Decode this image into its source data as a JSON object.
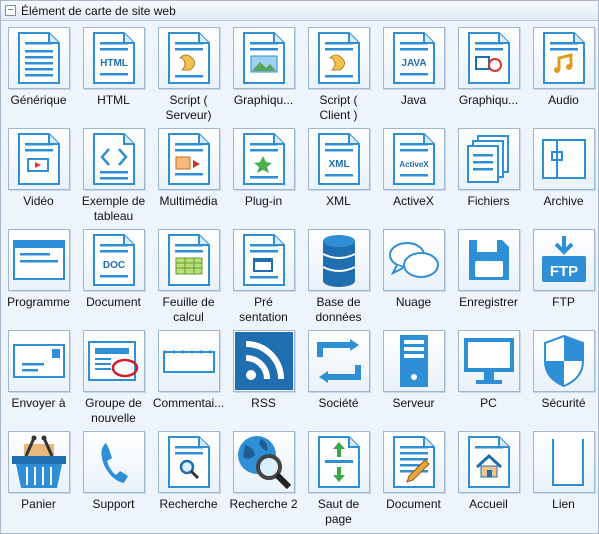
{
  "panel": {
    "title": "Élément de carte de site web",
    "collapse_symbol": "−"
  },
  "items": [
    {
      "label": "Générique",
      "icon": "generic-page-icon",
      "kind": "doc",
      "glyph": "lines"
    },
    {
      "label": "HTML",
      "icon": "html-page-icon",
      "kind": "doc",
      "glyph": "HTML"
    },
    {
      "label": "Script (\nServeur)",
      "icon": "server-script-icon",
      "kind": "doc",
      "glyph": "script"
    },
    {
      "label": "Graphiqu...",
      "icon": "graphic-page-icon",
      "kind": "doc",
      "glyph": "picture"
    },
    {
      "label": "Script (\nClient )",
      "icon": "client-script-icon",
      "kind": "doc",
      "glyph": "script"
    },
    {
      "label": "Java",
      "icon": "java-page-icon",
      "kind": "doc",
      "glyph": "JAVA"
    },
    {
      "label": "Graphiqu...",
      "icon": "graphic-shapes-icon",
      "kind": "doc",
      "glyph": "shapes"
    },
    {
      "label": "Audio",
      "icon": "audio-page-icon",
      "kind": "doc",
      "glyph": "note"
    },
    {
      "label": "Vidéo",
      "icon": "video-page-icon",
      "kind": "doc",
      "glyph": "video"
    },
    {
      "label": "Exemple de\ntableau",
      "icon": "template-page-icon",
      "kind": "doc",
      "glyph": "brackets"
    },
    {
      "label": "Multimédia",
      "icon": "multimedia-page-icon",
      "kind": "doc",
      "glyph": "media"
    },
    {
      "label": "Plug-in",
      "icon": "plugin-page-icon",
      "kind": "doc",
      "glyph": "star"
    },
    {
      "label": "XML",
      "icon": "xml-page-icon",
      "kind": "doc",
      "glyph": "XML"
    },
    {
      "label": "ActiveX",
      "icon": "activex-page-icon",
      "kind": "doc",
      "glyph": "ActiveX"
    },
    {
      "label": "Fichiers",
      "icon": "files-icon",
      "kind": "files"
    },
    {
      "label": "Archive",
      "icon": "archive-icon",
      "kind": "archive"
    },
    {
      "label": "Programme",
      "icon": "program-window-icon",
      "kind": "window"
    },
    {
      "label": "Document",
      "icon": "doc-file-icon",
      "kind": "doc",
      "glyph": "DOC"
    },
    {
      "label": "Feuille de\ncalcul",
      "icon": "spreadsheet-icon",
      "kind": "doc",
      "glyph": "sheet"
    },
    {
      "label": "Pré\nsentation",
      "icon": "presentation-icon",
      "kind": "doc",
      "glyph": "slide"
    },
    {
      "label": "Base de\ndonnées",
      "icon": "database-icon",
      "kind": "database"
    },
    {
      "label": "Nuage",
      "icon": "cloud-chat-icon",
      "kind": "cloud"
    },
    {
      "label": "Enregistrer",
      "icon": "save-disk-icon",
      "kind": "save"
    },
    {
      "label": "FTP",
      "icon": "ftp-icon",
      "kind": "ftp",
      "glyph": "FTP"
    },
    {
      "label": "Envoyer à",
      "icon": "envelope-icon",
      "kind": "mail"
    },
    {
      "label": "Groupe de\nnouvelle",
      "icon": "newsgroup-icon",
      "kind": "news"
    },
    {
      "label": "Commentai...",
      "icon": "comment-icon",
      "kind": "comment"
    },
    {
      "label": "RSS",
      "icon": "rss-icon",
      "kind": "rss"
    },
    {
      "label": "Société",
      "icon": "company-sync-icon",
      "kind": "sync"
    },
    {
      "label": "Serveur",
      "icon": "server-tower-icon",
      "kind": "server"
    },
    {
      "label": "PC",
      "icon": "pc-monitor-icon",
      "kind": "pc"
    },
    {
      "label": "Sécurité",
      "icon": "security-shield-icon",
      "kind": "shield"
    },
    {
      "label": "Panier",
      "icon": "shopping-basket-icon",
      "kind": "basket"
    },
    {
      "label": "Support",
      "icon": "support-phone-icon",
      "kind": "phone"
    },
    {
      "label": "Recherche",
      "icon": "search-page-icon",
      "kind": "doc",
      "glyph": "magnifier"
    },
    {
      "label": "Recherche 2",
      "icon": "globe-search-icon",
      "kind": "globe"
    },
    {
      "label": "Saut de\npage",
      "icon": "page-break-icon",
      "kind": "doc",
      "glyph": "arrows"
    },
    {
      "label": "Document",
      "icon": "edit-document-icon",
      "kind": "doc",
      "glyph": "pencil"
    },
    {
      "label": "Accueil",
      "icon": "home-page-icon",
      "kind": "doc",
      "glyph": "house"
    },
    {
      "label": "Lien",
      "icon": "link-icon",
      "kind": "link"
    }
  ],
  "colors": {
    "accent": "#2f8fd6",
    "accent_dark": "#1f6fb0",
    "tile_border": "#9fb6d1",
    "panel_bg": "#eef4fb"
  }
}
